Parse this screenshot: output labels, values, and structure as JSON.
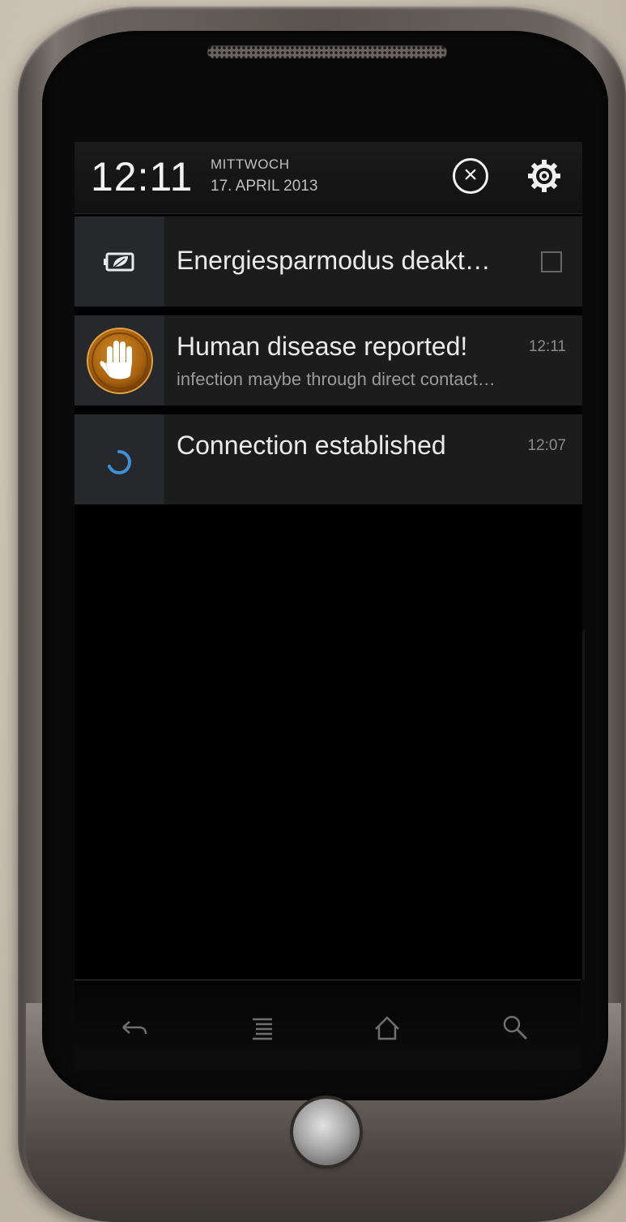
{
  "status_bar": {
    "time": "12:11",
    "weekday": "MITTWOCH",
    "date": "17. APRIL 2013",
    "clear_icon": "clear-all-icon",
    "settings_icon": "settings-gear-icon"
  },
  "notifications": [
    {
      "icon": "battery-leaf-icon",
      "title": "Energiesparmodus deakt…",
      "has_checkbox": true,
      "checked": false
    },
    {
      "icon": "raised-hand-icon",
      "title": "Human disease reported!",
      "time": "12:11",
      "subtitle": "infection maybe through direct contact…",
      "icon_color": "#b87416"
    },
    {
      "icon": "sync-spinner-icon",
      "title": "Connection established",
      "time": "12:07",
      "icon_color": "#3d8fd6"
    }
  ],
  "nav_bar": {
    "buttons": [
      "back-icon",
      "menu-icon",
      "home-icon",
      "search-icon"
    ]
  },
  "colors": {
    "screen_bg": "#000000",
    "notification_bg": "#1c1c1c",
    "icon_panel_bg": "#27282b"
  }
}
